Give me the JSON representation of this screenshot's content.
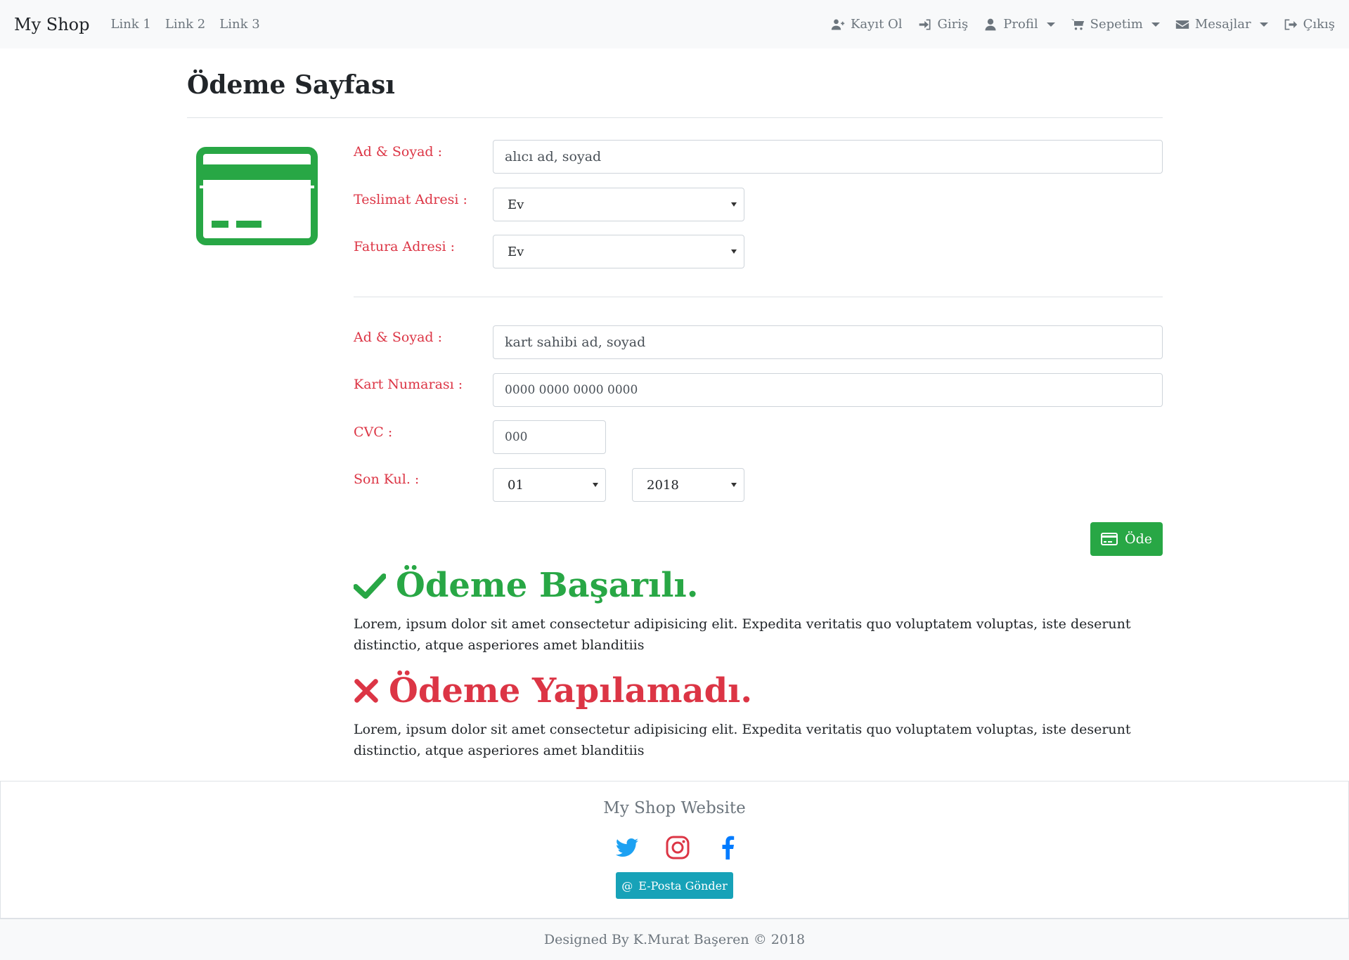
{
  "navbar": {
    "brand": "My Shop",
    "links": [
      "Link 1",
      "Link 2",
      "Link 3"
    ],
    "right": {
      "register": "Kayıt Ol",
      "login": "Giriş",
      "profile": "Profil",
      "cart": "Sepetim",
      "messages": "Mesajlar",
      "logout": "Çıkış"
    }
  },
  "page": {
    "title": "Ödeme Sayfası"
  },
  "form": {
    "recipient_label": "Ad & Soyad :",
    "recipient_placeholder": "alıcı ad, soyad",
    "delivery_label": "Teslimat Adresi :",
    "delivery_value": "Ev",
    "billing_label": "Fatura Adresi :",
    "billing_value": "Ev",
    "cardholder_label": "Ad & Soyad :",
    "cardholder_placeholder": "kart sahibi ad, soyad",
    "cardnumber_label": "Kart Numarası :",
    "cardnumber_placeholder": "0000 0000 0000 0000",
    "cvc_label": "CVC :",
    "cvc_placeholder": "000",
    "expiry_label": "Son Kul. :",
    "expiry_month": "01",
    "expiry_year": "2018",
    "pay_button": "Öde"
  },
  "results": {
    "success_title": "Ödeme Başarılı.",
    "success_text": "Lorem, ipsum dolor sit amet consectetur adipisicing elit. Expedita veritatis quo voluptatem voluptas, iste deserunt distinctio, atque asperiores amet blanditiis",
    "fail_title": "Ödeme Yapılamadı.",
    "fail_text": "Lorem, ipsum dolor sit amet consectetur adipisicing elit. Expedita veritatis quo voluptatem voluptas, iste deserunt distinctio, atque asperiores amet blanditiis"
  },
  "footer": {
    "title": "My Shop Website",
    "email_button": "E-Posta Gönder",
    "copyright": "Designed By K.Murat Başeren © 2018"
  },
  "colors": {
    "success": "#28a745",
    "danger": "#dc3545",
    "info": "#17a2b8",
    "twitter": "#1da1f2",
    "instagram": "#dc3545",
    "facebook": "#007bff"
  }
}
